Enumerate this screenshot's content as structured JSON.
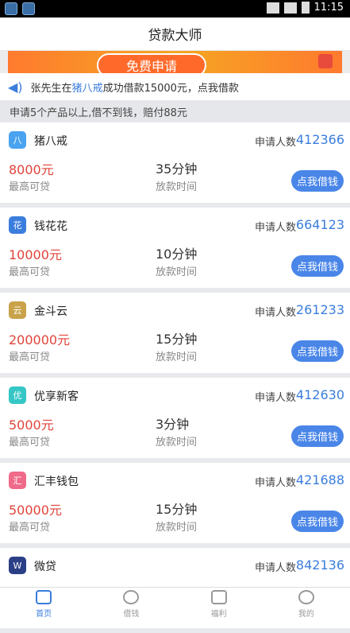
{
  "status": {
    "time": "11:15"
  },
  "header": {
    "title": "贷款大师"
  },
  "banner": {
    "button_label": "免费申请"
  },
  "notice": {
    "prefix": "张先生在",
    "highlight": "猪八戒",
    "suffix": "成功借款15000元，点我借款"
  },
  "promo": {
    "text": "申请5个产品以上,借不到钱，赔付88元"
  },
  "cards": [
    {
      "name": "猪八戒",
      "apply_label": "申请人数",
      "apply_count": "412366",
      "amount": "8000元",
      "amount_label": "最高可贷",
      "time": "35分钟",
      "time_label": "放款时间",
      "cta": "点我借钱",
      "icon_color": "#4aa3f0",
      "icon_char": "八"
    },
    {
      "name": "钱花花",
      "apply_label": "申请人数",
      "apply_count": "664123",
      "amount": "10000元",
      "amount_label": "最高可贷",
      "time": "10分钟",
      "time_label": "放款时间",
      "cta": "点我借钱",
      "icon_color": "#3b7ddd",
      "icon_char": "花"
    },
    {
      "name": "金斗云",
      "apply_label": "申请人数",
      "apply_count": "261233",
      "amount": "200000元",
      "amount_label": "最高可贷",
      "time": "15分钟",
      "time_label": "放款时间",
      "cta": "点我借钱",
      "icon_color": "#c9a24a",
      "icon_char": "云"
    },
    {
      "name": "优享新客",
      "apply_label": "申请人数",
      "apply_count": "412630",
      "amount": "5000元",
      "amount_label": "最高可贷",
      "time": "3分钟",
      "time_label": "放款时间",
      "cta": "点我借钱",
      "icon_color": "#36c6c6",
      "icon_char": "优"
    },
    {
      "name": "汇丰钱包",
      "apply_label": "申请人数",
      "apply_count": "421688",
      "amount": "50000元",
      "amount_label": "最高可贷",
      "time": "15分钟",
      "time_label": "放款时间",
      "cta": "点我借钱",
      "icon_color": "#f06a8a",
      "icon_char": "汇"
    },
    {
      "name": "微贷",
      "apply_label": "申请人数",
      "apply_count": "842136",
      "amount": "",
      "amount_label": "",
      "time": "",
      "time_label": "",
      "cta": "",
      "icon_color": "#2a3f86",
      "icon_char": "W"
    }
  ],
  "tabbar": {
    "items": [
      {
        "label": "首页",
        "icon": "store-icon",
        "active": true
      },
      {
        "label": "借钱",
        "icon": "dollar-icon",
        "active": false
      },
      {
        "label": "福利",
        "icon": "gift-icon",
        "active": false
      },
      {
        "label": "我的",
        "icon": "user-icon",
        "active": false
      }
    ]
  },
  "colors": {
    "accent": "#3b7ddd",
    "amount": "#e0443a",
    "button": "#4a86e8",
    "banner": "#ff7a2e"
  }
}
